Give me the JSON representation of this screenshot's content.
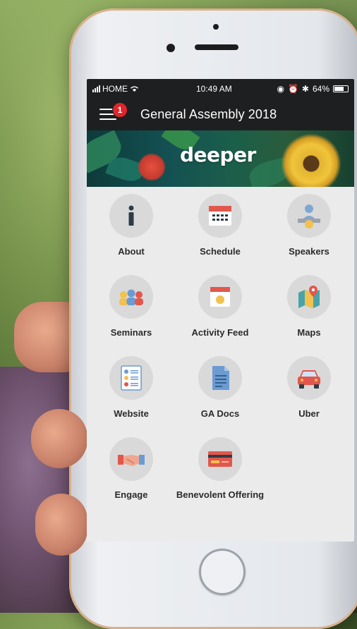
{
  "status_bar": {
    "carrier": "HOME",
    "time": "10:49 AM",
    "battery": "64%"
  },
  "nav": {
    "notification_count": "1",
    "title": "General Assembly 2018"
  },
  "banner": {
    "logo_text": "deeper"
  },
  "tiles": [
    {
      "label": "About",
      "icon": "info-icon"
    },
    {
      "label": "Schedule",
      "icon": "calendar-icon"
    },
    {
      "label": "Speakers",
      "icon": "speaker-icon"
    },
    {
      "label": "Seminars",
      "icon": "people-group-icon"
    },
    {
      "label": "Activity Feed",
      "icon": "activity-feed-icon"
    },
    {
      "label": "Maps",
      "icon": "map-pin-icon"
    },
    {
      "label": "Website",
      "icon": "website-list-icon"
    },
    {
      "label": "GA Docs",
      "icon": "document-icon"
    },
    {
      "label": "Uber",
      "icon": "car-icon"
    },
    {
      "label": "Engage",
      "icon": "handshake-icon"
    },
    {
      "label": "Benevolent Offering",
      "icon": "credit-card-icon"
    }
  ],
  "colors": {
    "bar_bg": "#1e1f21",
    "badge": "#e0252b",
    "tile_circle": "#d9d9d9",
    "screen_bg": "#ebebeb"
  }
}
